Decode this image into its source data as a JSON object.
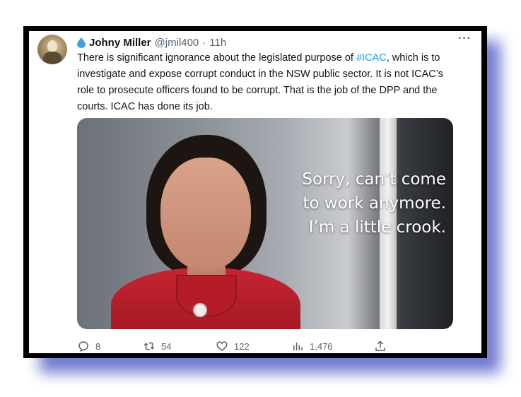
{
  "tweet": {
    "author": {
      "display_name": "Johny Miller",
      "handle": "@jmil400",
      "separator": "·",
      "timestamp": "11h"
    },
    "text_before_hashtag": "There is significant ignorance about the legislated purpose of ",
    "hashtag": "#ICAC",
    "text_after_hashtag": ", which is to investigate and expose corrupt conduct in the NSW public sector. It is not ICAC’s role to prosecute officers found to be corrupt. That is the job of the DPP and the courts. ICAC has done its job.",
    "media": {
      "caption_lines": [
        "Sorry, can’t come",
        "to work anymore.",
        "I’m a little crook."
      ]
    },
    "metrics": {
      "replies": "8",
      "retweets": "54",
      "likes": "122",
      "views": "1,476"
    },
    "more_label": "···"
  },
  "colors": {
    "hashtag": "#1d9bf0",
    "text": "#0f1419",
    "muted": "#536471",
    "frame": "#000000",
    "frame_shadow": "#5a64c8"
  },
  "icons": [
    "water-drop-icon",
    "more-icon",
    "reply-icon",
    "retweet-icon",
    "like-icon",
    "views-icon",
    "share-icon"
  ]
}
